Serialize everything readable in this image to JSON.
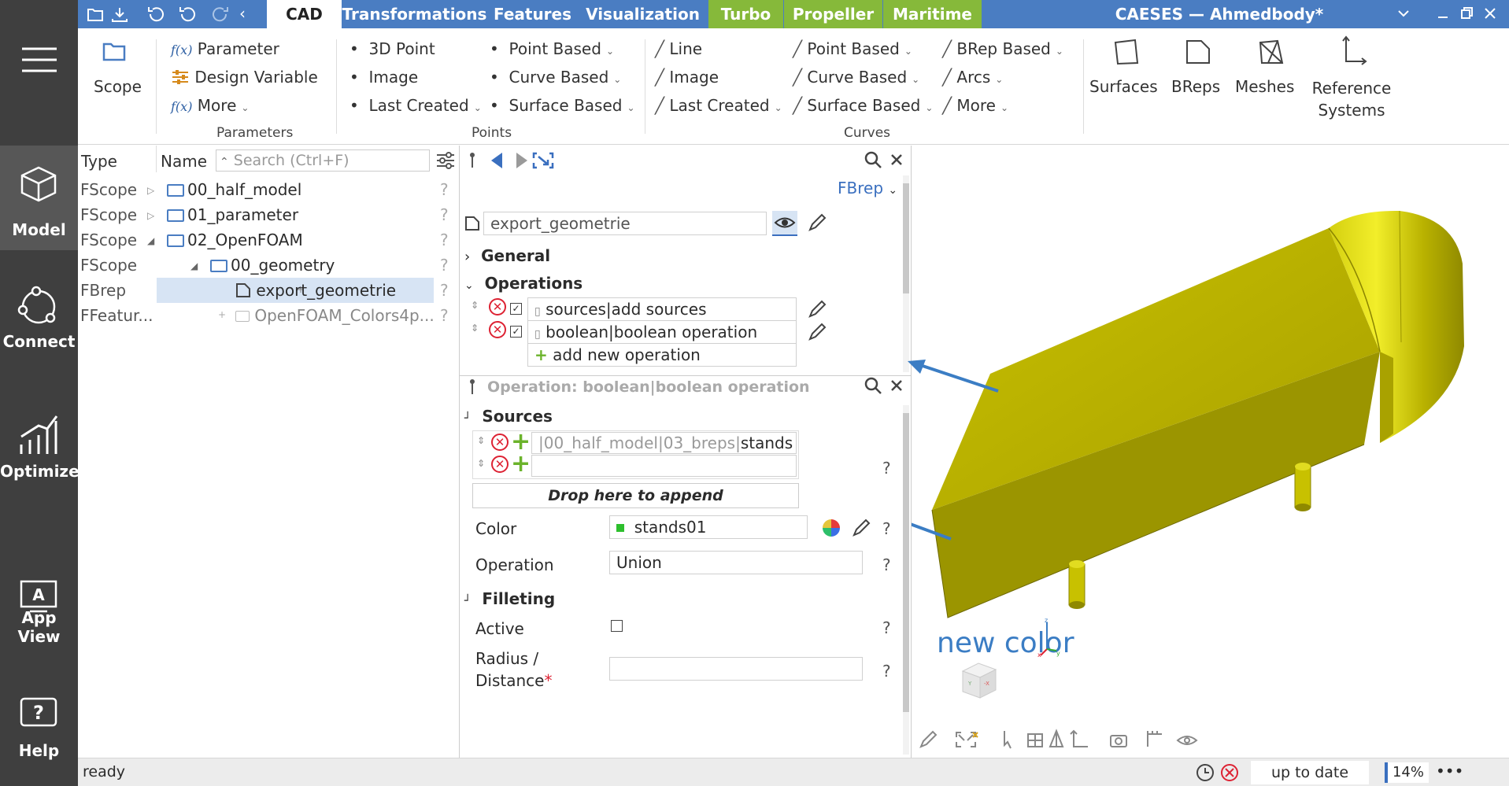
{
  "leftbar": {
    "items": [
      {
        "label": "Model",
        "icon": "cube-icon"
      },
      {
        "label": "Connect",
        "icon": "connect-icon"
      },
      {
        "label": "Optimize",
        "icon": "chart-icon"
      },
      {
        "label": "App View",
        "icon": "appview-icon"
      },
      {
        "label": "Help",
        "icon": "help-icon"
      }
    ]
  },
  "titlebar": {
    "tabs": [
      "CAD",
      "Transformations",
      "Features",
      "Visualization"
    ],
    "green_tabs": [
      "Turbo",
      "Propeller",
      "Maritime"
    ],
    "title": "CAESES — Ahmedbody*"
  },
  "ribbon": {
    "scope": "Scope",
    "parameters": {
      "items": [
        "Parameter",
        "Design Variable",
        "More"
      ],
      "group": "Parameters",
      "fx": "f(x)"
    },
    "points_col1": [
      "3D Point",
      "Image",
      "Last Created"
    ],
    "points_col2": [
      "Point Based",
      "Curve Based",
      "Surface Based"
    ],
    "points_group": "Points",
    "curves_col1": [
      "Line",
      "Image",
      "Last Created"
    ],
    "curves_col2": [
      "Point Based",
      "Curve Based",
      "Surface Based"
    ],
    "curves_col3": [
      "BRep Based",
      "Arcs",
      "More"
    ],
    "curves_group": "Curves",
    "big": [
      "Surfaces",
      "BReps",
      "Meshes"
    ],
    "refsys": [
      "Reference",
      "Systems"
    ]
  },
  "tree": {
    "header_type": "Type",
    "header_name": "Name",
    "search_placeholder": "Search (Ctrl+F)",
    "rows": [
      {
        "type": "FScope",
        "name": "00_half_model"
      },
      {
        "type": "FScope",
        "name": "01_parameter"
      },
      {
        "type": "FScope",
        "name": "02_OpenFOAM"
      },
      {
        "type": "FScope",
        "name": "00_geometry"
      },
      {
        "type": "FBrep",
        "name": "export_geometrie"
      },
      {
        "type": "FFeatur...",
        "name": "OpenFOAM_Colors4p..."
      }
    ]
  },
  "props": {
    "type_label": "FBrep",
    "object_name": "export_geometrie",
    "general": "General",
    "operations": "Operations",
    "ops": [
      "sources|add sources",
      "boolean|boolean operation"
    ],
    "add_op": "add new operation",
    "op_title": "Operation: boolean|boolean operation",
    "sources": "Sources",
    "source_path": "|00_half_model|03_breps|",
    "source_leaf": "stands",
    "drop": "Drop here to append",
    "color_label": "Color",
    "color_value": "stands01",
    "operation_label": "Operation",
    "operation_value": "Union",
    "filleting": "Filleting",
    "active_label": "Active",
    "radius_label": "Radius /",
    "distance_label": "Distance",
    "required_mark": "*",
    "help_mark": "?"
  },
  "annotation": {
    "text": "new color",
    "color": "#3b7dc4"
  },
  "axes": {
    "z": "z",
    "x": "x",
    "y": "y",
    "neg_x": "-X",
    "neg_y": "Y"
  },
  "status": {
    "text": "ready",
    "update": "up to date",
    "zoom": "14%",
    "more": "•••"
  },
  "colors": {
    "accent": "#4a7dc2",
    "green_tab": "#86b93a",
    "body": "#b8b000",
    "body_dark": "#8f8900",
    "body_light": "#e6e21a",
    "stands_swatch": "#2dbf2d"
  }
}
